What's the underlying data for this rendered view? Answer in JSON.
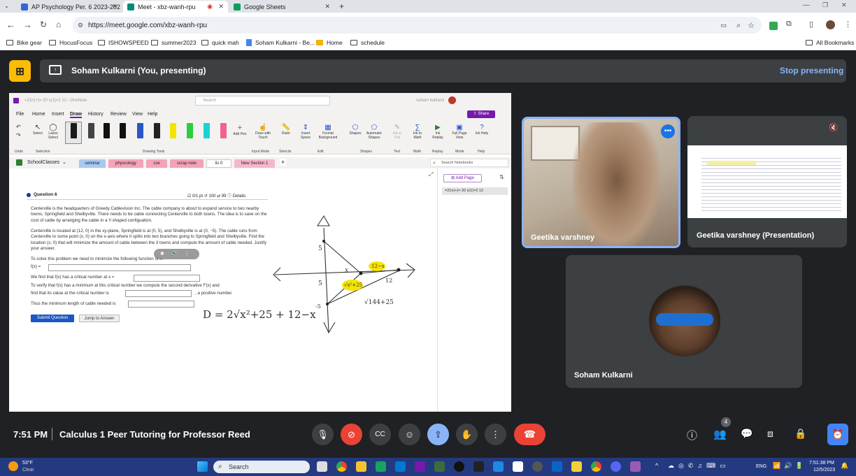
{
  "browser": {
    "tabs": [
      {
        "title": "AP Psychology Per. 6 2023-202",
        "color": "#3367d6"
      },
      {
        "title": "Meet - xbz-wanh-rpu",
        "color": "#00897b"
      },
      {
        "title": "Google Sheets",
        "color": "#0f9d58"
      }
    ],
    "url": "https://meet.google.com/xbz-wanh-rpu",
    "bookmarks": [
      "Bike gear",
      "HocusFocus",
      "ISHOWSPEED",
      "summer2023",
      "quick mah",
      "Soham Kulkarni - Be...",
      "Home",
      "schedule"
    ],
    "all_bookmarks": "All Bookmarks"
  },
  "meet": {
    "presenting_label": "Soham Kulkarni (You, presenting)",
    "stop_presenting": "Stop presenting",
    "time": "7:51 PM",
    "meeting_title": "Calculus 1 Peer Tutoring for Professor Reed",
    "participants_count": "4",
    "tiles": [
      {
        "name": "Geetika varshney"
      },
      {
        "name": "Geetika varshney (Presentation)"
      },
      {
        "name": "Soham Kulkarni"
      }
    ]
  },
  "onenote": {
    "title": "=21n(+)= 20 s(1)=2 12 - OneNote",
    "search": "Search",
    "user": "soham kulkarni",
    "menu": [
      "File",
      "Home",
      "Insert",
      "Draw",
      "History",
      "Review",
      "View",
      "Help"
    ],
    "share": "Share",
    "ribbon_groups": [
      "Undo",
      "Selection",
      "Drawing Tools",
      "Input Mode",
      "Stencils",
      "Edit",
      "Shapes",
      "Text",
      "Math",
      "Replay",
      "Mode",
      "Help"
    ],
    "ribbon_tools": [
      "Select",
      "Lasso Select",
      "Add Pen",
      "Draw with Touch",
      "Ruler",
      "Insert Space",
      "Format Background",
      "Shapes",
      "Automatic Shapes",
      "Ink to Text",
      "Ink to Math",
      "Ink Replay",
      "Full Page View",
      "Ink Help"
    ],
    "notebook": "SchoolClasses",
    "sections": [
      "seminar",
      "physcology",
      "cse",
      "scrap note",
      "lis 0",
      "New Section 1"
    ],
    "search_notebooks": "Search Notebooks",
    "add_page": "Add Page",
    "page_item": "=21n(+)= 20 s(1)=2 12"
  },
  "question": {
    "label": "Question 6",
    "meta": [
      "0/1 pt",
      "100",
      "99",
      "Details"
    ],
    "p1": "Centerville is the headquarters of Greedy Cablevision Inc. The cable company is about to expand service to two nearby towns, Springfield and Shelbyville. There needs to be cable connecting Centerville to both towns. The idea is to save on the cost of cable by arranging the cable in a Y-shaped configuation.",
    "p2": "Centerville is located at (12, 0) in the xy-plane, Springfield is at (0, 5), and Shelbyville is at (0, −5). The cable runs from Centerville to some point (x, 0) on the x-axis where it splits into two branches going to Springfield and Shelbyville. Find the location (x, 0) that will minimize the amount of cable between the 3 towns and compute the amount of cable needed. Justify your answer.",
    "l1": "To solve this problem we need to minimize the following function of x:",
    "l2": "f(x) =",
    "l3": "We find that f(x) has a critical number at x =",
    "l4": "To verify that f(x) has a minimum at this critical number we compute the second derivative f″(x) and",
    "l5": "find that its value at the critical number is",
    "l5b": ", a positive number.",
    "l6": "Thus the minimum length of cable needed is",
    "submit": "Submit Question",
    "jump": "Jump to Answer"
  },
  "handwriting": {
    "d": "D = 2√x²+25 + 12−x",
    "sqrt": "√144+25",
    "highlight1": "12−x",
    "highlight2": "√x²+25",
    "n5": "5",
    "n5b": "5",
    "nm5": "-5",
    "n12": "12",
    "x": "x"
  },
  "taskbar": {
    "weather_temp": "53°F",
    "weather_desc": "Clear",
    "search": "Search",
    "lang": "ENG",
    "clock_time": "7:51:38 PM",
    "clock_date": "12/5/2023"
  }
}
